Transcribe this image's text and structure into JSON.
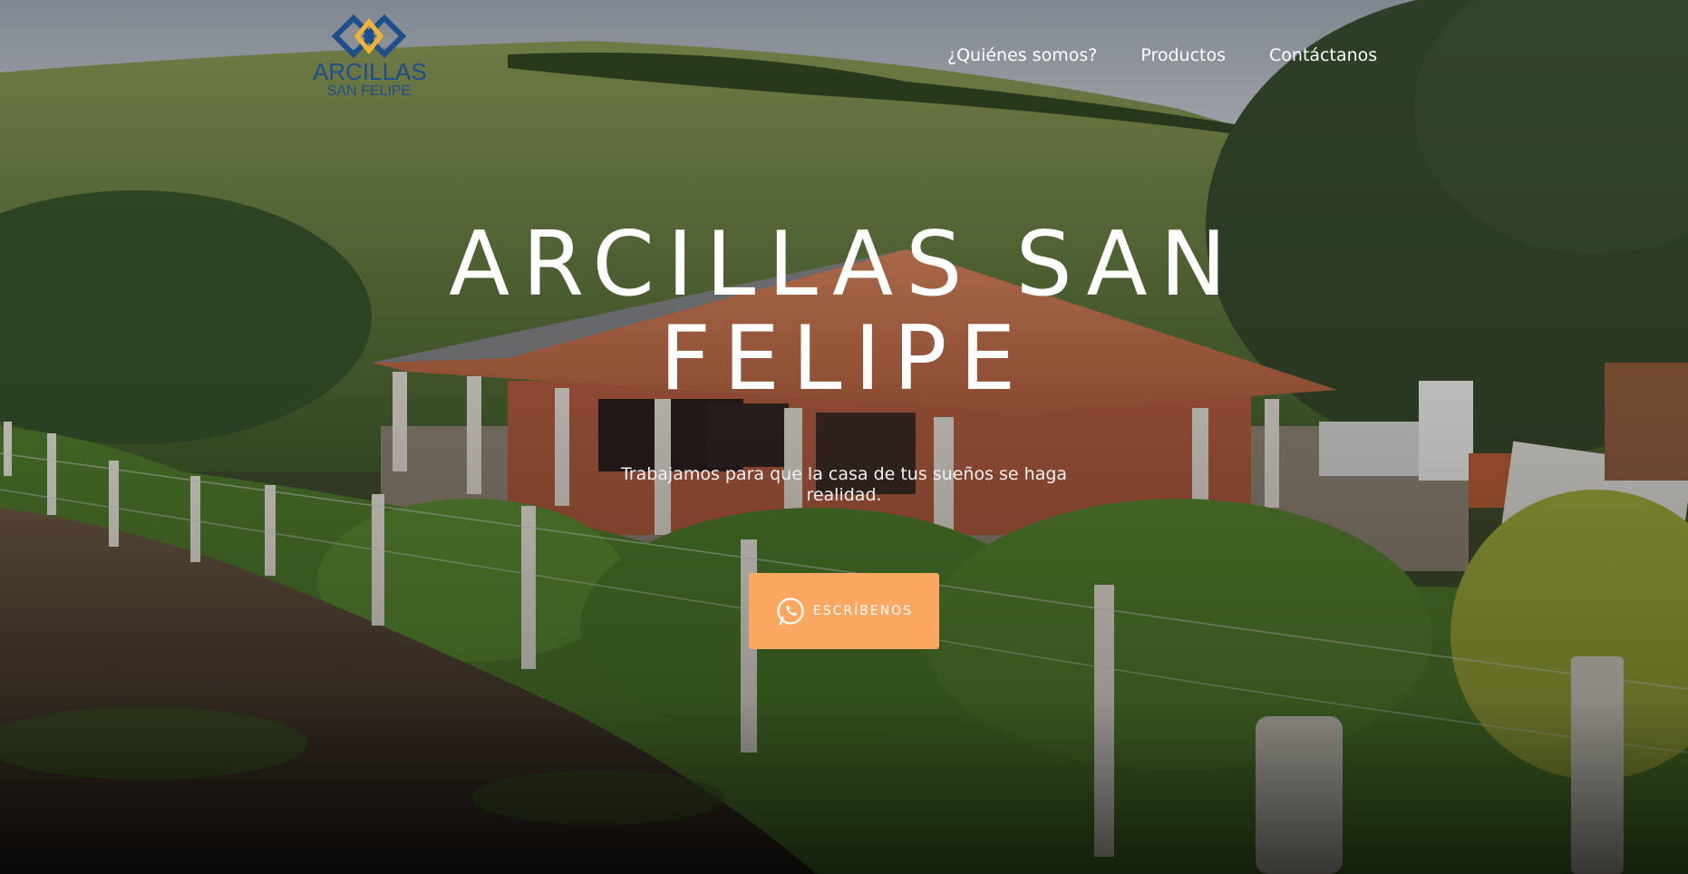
{
  "brand": {
    "name": "ARCILLAS",
    "subtitle": "SAN FELIPE",
    "logo_colors": {
      "primary": "#1f4e8c",
      "accent": "#f2b330"
    }
  },
  "nav": {
    "items": [
      {
        "label": "¿Quiénes somos?"
      },
      {
        "label": "Productos"
      },
      {
        "label": "Contáctanos"
      }
    ]
  },
  "hero": {
    "title": "ARCILLAS SAN FELIPE",
    "subtitle": "Trabajamos para que la casa de tus sueños se haga realidad.",
    "cta": {
      "label": "ESCRÍBENOS",
      "icon": "whatsapp-icon",
      "color": "#fba862"
    }
  }
}
